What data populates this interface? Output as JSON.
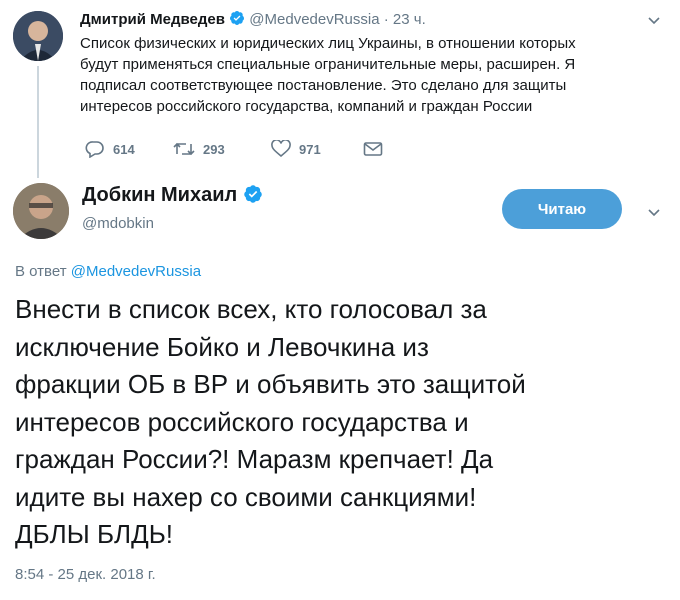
{
  "parent_tweet": {
    "author_name": "Дмитрий Медведев",
    "handle": "@MedvedevRussia",
    "separator": "·",
    "time": "23 ч.",
    "body_lines": [
      "Список физических и юридических лиц Украины, в отношении которых",
      "будут применяться специальные ограничительные меры, расширен. Я",
      "подписал соответствующее постановление. Это сделано для защиты",
      "интересов российского государства, компаний и граждан России"
    ],
    "replies": "614",
    "retweets": "293",
    "likes": "971"
  },
  "main_tweet": {
    "author_name": "Добкин Михаил",
    "handle": "@mdobkin",
    "follow_label": "Читаю",
    "reply_prefix": "В ответ",
    "reply_handle": "@MedvedevRussia",
    "body_lines": [
      "Внести в список всех, кто голосовал за",
      "исключение Бойко и Левочкина из",
      "фракции ОБ в ВР и объявить это защитой",
      "интересов российского государства и",
      "граждан России?! Маразм крепчает! Да",
      "идите вы нахер со своими санкциями!",
      "ДБЛЫ БЛДЬ!"
    ],
    "timestamp": "8:54 - 25 дек. 2018 г."
  },
  "colors": {
    "accent": "#1b95e0",
    "button": "#4c9fd9",
    "secondary_text": "#657786",
    "verified_badge": "#1da1f2"
  }
}
